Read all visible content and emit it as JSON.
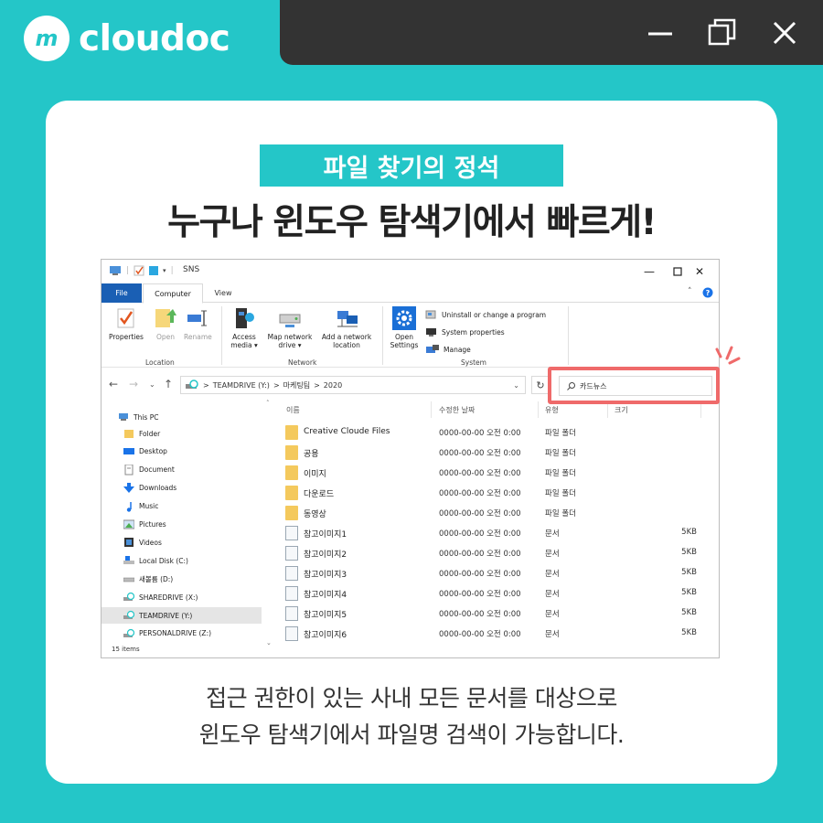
{
  "brand": {
    "name": "cloudoc"
  },
  "card": {
    "tag": "파일 찾기의 정석",
    "headline": "누구나 윈도우 탐색기에서 빠르게!",
    "desc_line1": "접근 권한이 있는 사내 모든 문서를 대상으로",
    "desc_line2": "윈도우 탐색기에서 파일명 검색이 가능합니다."
  },
  "explorer": {
    "title": "SNS",
    "tabs": [
      "File",
      "Computer",
      "View"
    ],
    "ribbon": {
      "location": {
        "properties": "Properties",
        "open": "Open",
        "rename": "Rename",
        "group": "Location"
      },
      "network": {
        "access_media": "Access media ▾",
        "map_drive": "Map network drive ▾",
        "add_location": "Add a network location",
        "group": "Network"
      },
      "system": {
        "open_settings": "Open Settings",
        "uninstall": "Uninstall or change a program",
        "properties": "System properties",
        "manage": "Manage",
        "group": "System"
      }
    },
    "address": {
      "drive": "TEAMDRIVE (Y:)",
      "folder": "마케팅팀",
      "sub": "2020",
      "sep": ">"
    },
    "search": {
      "value": "카드뉴스"
    },
    "sidebar": [
      "This PC",
      "Folder",
      "Desktop",
      "Document",
      "Downloads",
      "Music",
      "Pictures",
      "Videos",
      "Local Disk (C:)",
      "새볼륨 (D:)",
      "SHAREDRIVE (X:)",
      "TEAMDRIVE (Y:)",
      "PERSONALDRIVE (Z:)"
    ],
    "columns": [
      "이름",
      "수정한 날짜",
      "유형",
      "크기"
    ],
    "files": [
      {
        "name": "Creative Cloude Files",
        "date": "0000-00-00 오전 0:00",
        "type": "파일 폴더",
        "size": "",
        "kind": "folder"
      },
      {
        "name": "공용",
        "date": "0000-00-00 오전 0:00",
        "type": "파일 폴더",
        "size": "",
        "kind": "folder"
      },
      {
        "name": "이미지",
        "date": "0000-00-00 오전 0:00",
        "type": "파일 폴더",
        "size": "",
        "kind": "folder"
      },
      {
        "name": "다운로드",
        "date": "0000-00-00 오전 0:00",
        "type": "파일 폴더",
        "size": "",
        "kind": "folder"
      },
      {
        "name": "동영상",
        "date": "0000-00-00 오전 0:00",
        "type": "파일 폴더",
        "size": "",
        "kind": "folder"
      },
      {
        "name": "참고이미지1",
        "date": "0000-00-00 오전 0:00",
        "type": "문서",
        "size": "5KB",
        "kind": "doc"
      },
      {
        "name": "참고이미지2",
        "date": "0000-00-00 오전 0:00",
        "type": "문서",
        "size": "5KB",
        "kind": "doc"
      },
      {
        "name": "참고이미지3",
        "date": "0000-00-00 오전 0:00",
        "type": "문서",
        "size": "5KB",
        "kind": "doc"
      },
      {
        "name": "참고이미지4",
        "date": "0000-00-00 오전 0:00",
        "type": "문서",
        "size": "5KB",
        "kind": "doc"
      },
      {
        "name": "참고이미지5",
        "date": "0000-00-00 오전 0:00",
        "type": "문서",
        "size": "5KB",
        "kind": "doc"
      },
      {
        "name": "참고이미지6",
        "date": "0000-00-00 오전 0:00",
        "type": "문서",
        "size": "5KB",
        "kind": "doc"
      }
    ],
    "status": "15 items"
  },
  "colors": {
    "brand": "#24c6c8",
    "titlebar": "#333333",
    "highlight": "#ef6a6a",
    "file_tab": "#1a5fb4"
  },
  "icons": [
    "m-logo-icon",
    "minimize-icon",
    "maximize-icon",
    "close-icon",
    "folder-icon",
    "document-icon",
    "search-icon",
    "refresh-icon",
    "help-icon"
  ]
}
